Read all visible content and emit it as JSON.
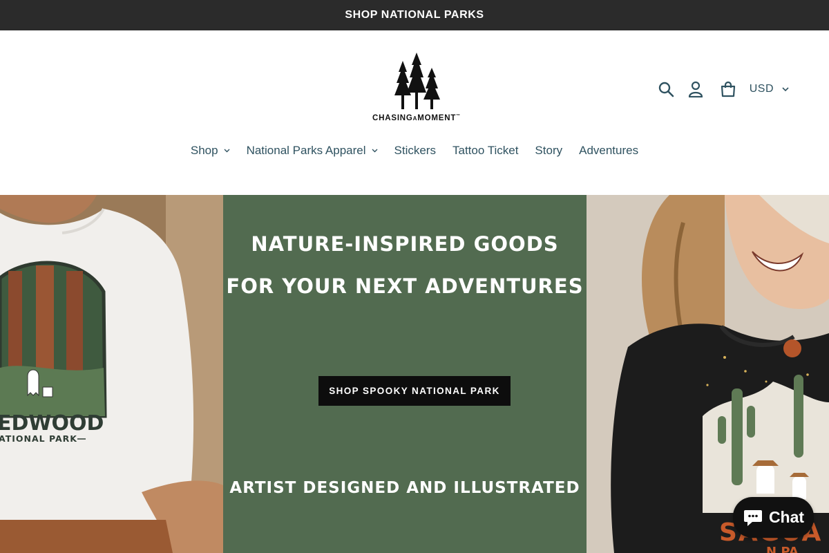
{
  "announcement": {
    "text": "SHOP NATIONAL PARKS"
  },
  "brand": {
    "logo_text": "CHASINGAMOMENT",
    "logo_prefix": "CHASING",
    "logo_a": "A",
    "logo_suffix": "MOMENT",
    "trademark": "™"
  },
  "header": {
    "currency": "USD",
    "icons": [
      "search-icon",
      "account-icon",
      "cart-icon",
      "chevron-down-icon"
    ]
  },
  "nav": {
    "items": [
      {
        "label": "Shop",
        "has_dropdown": true
      },
      {
        "label": "National Parks Apparel",
        "has_dropdown": true
      },
      {
        "label": "Stickers",
        "has_dropdown": false
      },
      {
        "label": "Tattoo Ticket",
        "has_dropdown": false
      },
      {
        "label": "Story",
        "has_dropdown": false
      },
      {
        "label": "Adventures",
        "has_dropdown": false
      }
    ]
  },
  "hero": {
    "headline_line1": "NATURE-INSPIRED GOODS",
    "headline_line2": "FOR YOUR NEXT ADVENTURES",
    "button_label": "SHOP SPOOKY NATIONAL PARK",
    "tagline": "ARTIST DESIGNED AND ILLUSTRATED",
    "left_shirt_text_1": "EDWOOD",
    "left_shirt_text_2": "ATIONAL PARK",
    "right_shirt_text_1": "SAGUA",
    "right_shirt_text_2": "N PA"
  },
  "chat": {
    "label": "Chat"
  },
  "colors": {
    "announcement_bg": "#2b2b2b",
    "text_accent": "#2f5260",
    "hero_center_bg": "#526b50",
    "button_bg": "#0d0d0d"
  }
}
